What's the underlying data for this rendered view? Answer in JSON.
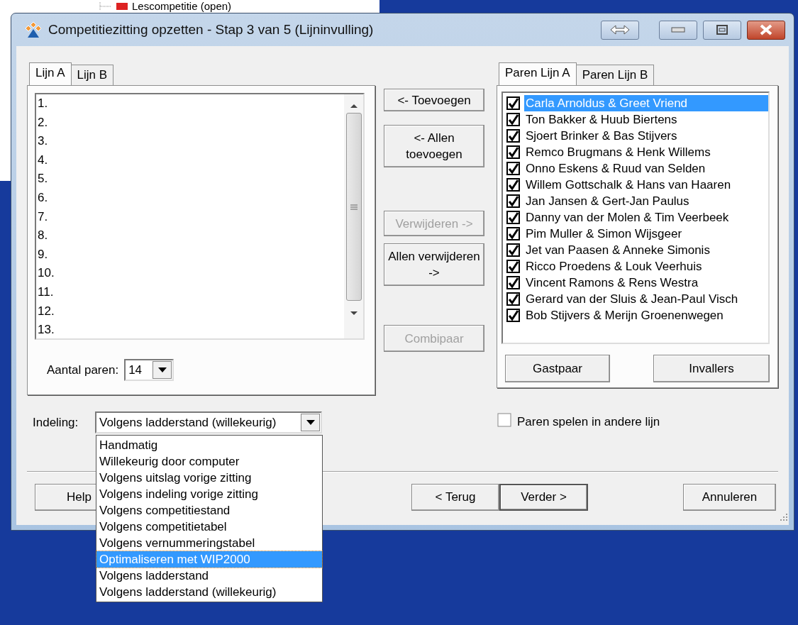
{
  "background_window": {
    "tree_item": "Lescompetitie (open)"
  },
  "window": {
    "title": "Competitiezitting opzetten - Stap 3 van 5 (Lijninvulling)"
  },
  "left_tabs": [
    {
      "label": "Lijn A",
      "selected": true
    },
    {
      "label": "Lijn B",
      "selected": false
    }
  ],
  "lines": [
    "1.",
    "2.",
    "3.",
    "4.",
    "5.",
    "6.",
    "7.",
    "8.",
    "9.",
    "10.",
    "11.",
    "12.",
    "13."
  ],
  "pair_count": {
    "label": "Aantal paren:",
    "value": "14"
  },
  "middle_buttons": [
    {
      "label": "<- Toevoegen",
      "disabled": false
    },
    {
      "label": "<- Allen toevoegen",
      "disabled": false
    },
    {
      "label": "Verwijderen ->",
      "disabled": true
    },
    {
      "label": "Allen verwijderen ->",
      "disabled": false
    },
    {
      "label": "Combipaar",
      "disabled": true
    }
  ],
  "right_tabs": [
    {
      "label": "Paren Lijn A",
      "selected": true
    },
    {
      "label": "Paren Lijn B",
      "selected": false
    }
  ],
  "pairs": [
    {
      "name": "Carla Arnoldus & Greet Vriend",
      "checked": true,
      "selected": true
    },
    {
      "name": "Ton Bakker & Huub Biertens",
      "checked": true,
      "selected": false
    },
    {
      "name": "Sjoert Brinker & Bas Stijvers",
      "checked": true,
      "selected": false
    },
    {
      "name": "Remco Brugmans & Henk Willems",
      "checked": true,
      "selected": false
    },
    {
      "name": "Onno Eskens & Ruud van Selden",
      "checked": true,
      "selected": false
    },
    {
      "name": "Willem Gottschalk & Hans van Haaren",
      "checked": true,
      "selected": false
    },
    {
      "name": "Jan Jansen & Gert-Jan Paulus",
      "checked": true,
      "selected": false
    },
    {
      "name": "Danny van der Molen & Tim Veerbeek",
      "checked": true,
      "selected": false
    },
    {
      "name": "Pim Muller & Simon Wijsgeer",
      "checked": true,
      "selected": false
    },
    {
      "name": "Jet van Paasen & Anneke Simonis",
      "checked": true,
      "selected": false
    },
    {
      "name": "Ricco Proedens & Louk Veerhuis",
      "checked": true,
      "selected": false
    },
    {
      "name": "Vincent Ramons & Rens Westra",
      "checked": true,
      "selected": false
    },
    {
      "name": "Gerard van der Sluis & Jean-Paul Visch",
      "checked": true,
      "selected": false
    },
    {
      "name": "Bob Stijvers & Merijn Groenenwegen",
      "checked": true,
      "selected": false
    }
  ],
  "pair_buttons": [
    "Gastpaar",
    "Invallers"
  ],
  "other_line": {
    "label": "Paren spelen in andere lijn",
    "checked": false
  },
  "indeling": {
    "label": "Indeling:",
    "value": "Volgens ladderstand (willekeurig)",
    "expanded": true,
    "options": [
      {
        "label": "Handmatig",
        "highlighted": false
      },
      {
        "label": "Willekeurig door computer",
        "highlighted": false
      },
      {
        "label": "Volgens uitslag vorige zitting",
        "highlighted": false
      },
      {
        "label": "Volgens indeling vorige zitting",
        "highlighted": false
      },
      {
        "label": "Volgens competitiestand",
        "highlighted": false
      },
      {
        "label": "Volgens competitietabel",
        "highlighted": false
      },
      {
        "label": "Volgens vernummeringstabel",
        "highlighted": false
      },
      {
        "label": "Optimaliseren met WIP2000",
        "highlighted": true
      },
      {
        "label": "Volgens ladderstand",
        "highlighted": false
      },
      {
        "label": "Volgens ladderstand (willekeurig)",
        "highlighted": false
      }
    ]
  },
  "footer_buttons": [
    {
      "label": "Help",
      "default": false
    },
    {
      "label": "< Terug",
      "default": false
    },
    {
      "label": "Verder >",
      "default": true
    },
    {
      "label": "Annuleren",
      "default": false
    }
  ]
}
